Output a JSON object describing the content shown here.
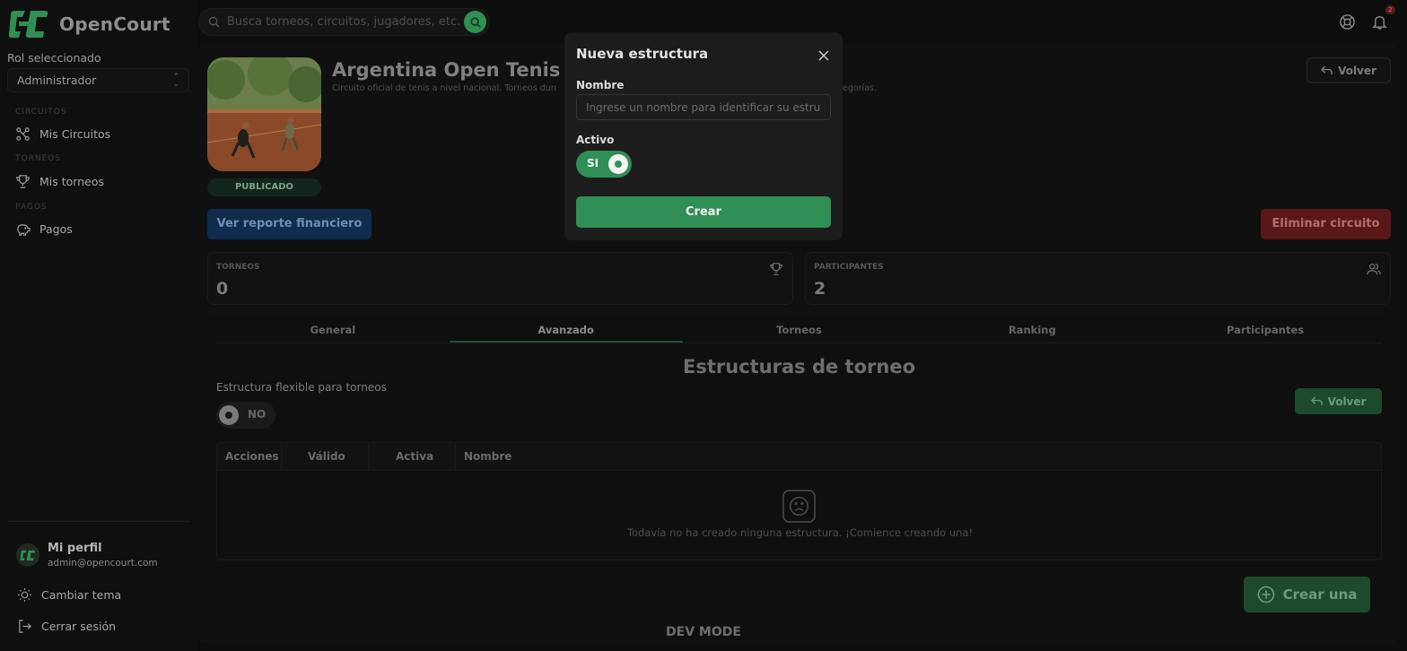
{
  "brand": {
    "name": "OpenCourt",
    "accent": "#2f8f55"
  },
  "sidebar": {
    "role_label": "Rol seleccionado",
    "role_value": "Administrador",
    "sections": [
      {
        "label": "CIRCUITOS",
        "item": "Mis Circuitos",
        "icon": "network-icon"
      },
      {
        "label": "TORNEOS",
        "item": "Mis torneos",
        "icon": "trophy-icon"
      },
      {
        "label": "PAGOS",
        "item": "Pagos",
        "icon": "piggy-bank-icon"
      }
    ],
    "profile": {
      "name": "Mi perfil",
      "email": "admin@opencourt.com"
    },
    "theme_label": "Cambiar tema",
    "logout_label": "Cerrar sesión"
  },
  "topbar": {
    "search_placeholder": "Busca torneos, circuitos, jugadores, etc.",
    "notification_count": "2"
  },
  "circuit": {
    "title": "Argentina Open Tenis",
    "description_start": "Circuito oficial de tenis a nivel nacional. Torneos duro",
    "description_end": "egorías.",
    "status": "PUBLICADO",
    "back_label": "Volver",
    "report_label": "Ver reporte financiero",
    "delete_label": "Eliminar circuito"
  },
  "stats": [
    {
      "label": "TORNEOS",
      "value": "0",
      "icon": "trophy-icon"
    },
    {
      "label": "PARTICIPANTES",
      "value": "2",
      "icon": "users-icon"
    }
  ],
  "tabs": [
    "General",
    "Avanzado",
    "Torneos",
    "Ranking",
    "Participantes"
  ],
  "structures": {
    "title": "Estructuras de torneo",
    "flex_label": "Estructura flexible para torneos",
    "flex_toggle": "NO",
    "back_label": "Volver",
    "columns": [
      "Acciones",
      "Válido",
      "Activa",
      "Nombre"
    ],
    "empty_text": "Todavía no ha creado ninguna estructura. ¡Comience creando una!",
    "create_label": "Crear una"
  },
  "dev_mode": "DEV MODE",
  "modal": {
    "title": "Nueva estructura",
    "name_label": "Nombre",
    "name_placeholder": "Ingrese un nombre para identificar su estructura",
    "active_label": "Activo",
    "active_toggle": "SI",
    "create_label": "Crear"
  }
}
